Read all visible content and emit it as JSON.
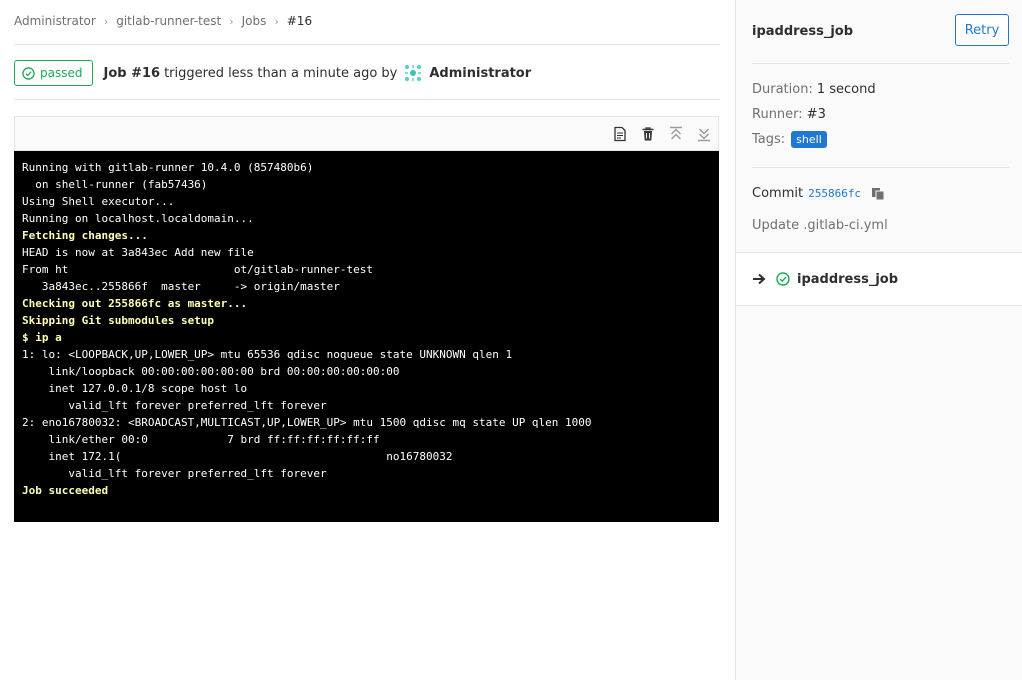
{
  "breadcrumb": [
    "Administrator",
    "gitlab-runner-test",
    "Jobs",
    "#16"
  ],
  "header": {
    "status": "passed",
    "job_label": "Job #16",
    "triggered_text": "triggered less than a minute ago by",
    "author": "Administrator"
  },
  "toolbar": {
    "icons": [
      "raw-log-icon",
      "erase-log-icon",
      "scroll-top-icon",
      "scroll-bottom-icon"
    ]
  },
  "log": {
    "lines": [
      {
        "text": "Running with gitlab-runner 10.4.0 (857480b6)",
        "style": ""
      },
      {
        "text": "  on shell-runner (fab57436)",
        "style": ""
      },
      {
        "text": "Using Shell executor...",
        "style": ""
      },
      {
        "text": "Running on localhost.localdomain...",
        "style": ""
      },
      {
        "text": "Fetching changes...",
        "style": "hl"
      },
      {
        "text": "HEAD is now at 3a843ec Add new file",
        "style": ""
      },
      {
        "text": "From ht                         ot/gitlab-runner-test",
        "style": ""
      },
      {
        "text": "   3a843ec..255866f  master     -> origin/master",
        "style": ""
      },
      {
        "text": "Checking out 255866fc as master...",
        "style": "hl"
      },
      {
        "text": "Skipping Git submodules setup",
        "style": "hl"
      },
      {
        "text": "$ ip a",
        "style": "hl"
      },
      {
        "text": "1: lo: <LOOPBACK,UP,LOWER_UP> mtu 65536 qdisc noqueue state UNKNOWN qlen 1",
        "style": ""
      },
      {
        "text": "    link/loopback 00:00:00:00:00:00 brd 00:00:00:00:00:00",
        "style": ""
      },
      {
        "text": "    inet 127.0.0.1/8 scope host lo",
        "style": ""
      },
      {
        "text": "       valid_lft forever preferred_lft forever",
        "style": ""
      },
      {
        "text": "2: eno16780032: <BROADCAST,MULTICAST,UP,LOWER_UP> mtu 1500 qdisc mq state UP qlen 1000",
        "style": ""
      },
      {
        "text": "    link/ether 00:0            7 brd ff:ff:ff:ff:ff:ff",
        "style": ""
      },
      {
        "text": "    inet 172.1(                                        no16780032",
        "style": ""
      },
      {
        "text": "       valid_lft forever preferred_lft forever",
        "style": ""
      },
      {
        "text": "Job succeeded",
        "style": "ok"
      }
    ]
  },
  "sidebar": {
    "job_name": "ipaddress_job",
    "retry_label": "Retry",
    "duration_label": "Duration:",
    "duration_value": "1 second",
    "runner_label": "Runner:",
    "runner_value": "#3",
    "tags_label": "Tags:",
    "tag": "shell",
    "commit_label": "Commit",
    "commit_sha": "255866fc",
    "commit_message": "Update .gitlab-ci.yml",
    "jobs": [
      {
        "name": "ipaddress_job",
        "status": "passed"
      }
    ]
  },
  "colors": {
    "success": "#1aaa55",
    "link": "#1f78d1",
    "log_bg": "#000000",
    "log_highlight": "#ffffb3"
  }
}
